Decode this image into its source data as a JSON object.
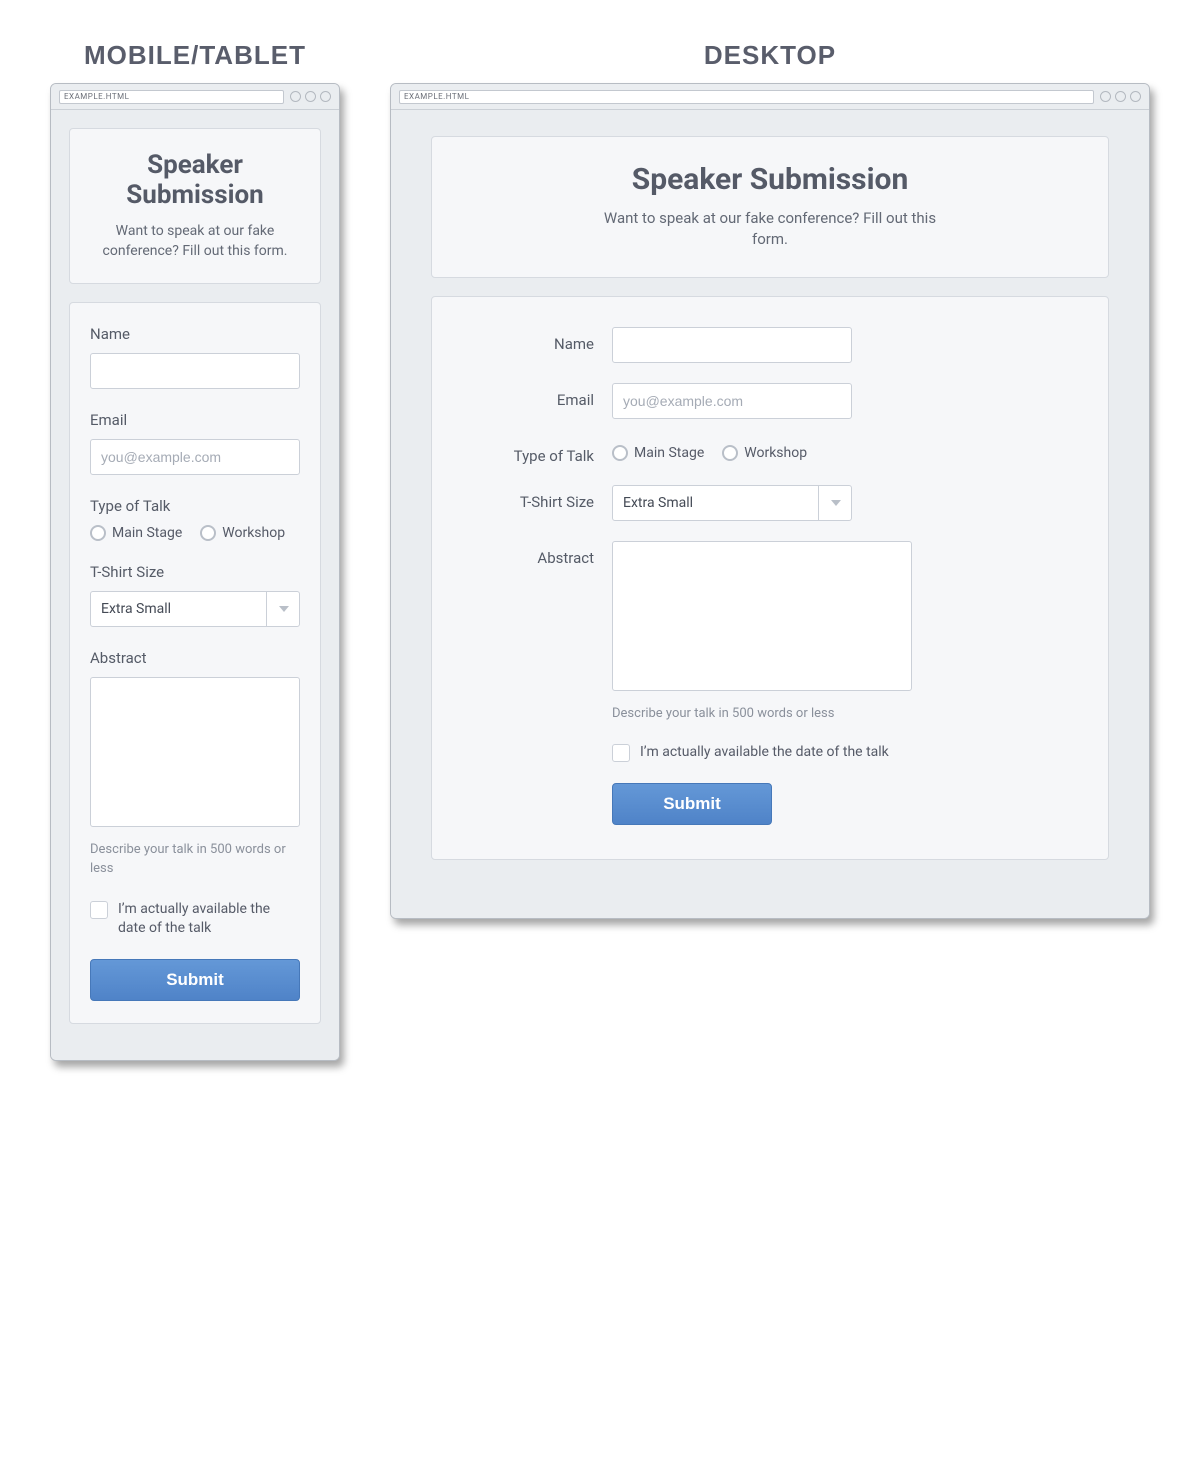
{
  "labels": {
    "mobile_heading": "Mobile/Tablet",
    "desktop_heading": "Desktop"
  },
  "browser": {
    "url": "EXAMPLE.HTML"
  },
  "header": {
    "title": "Speaker Submission",
    "subtitle": "Want to speak at our fake conference? Fill out this form."
  },
  "form": {
    "name_label": "Name",
    "email_label": "Email",
    "email_placeholder": "you@example.com",
    "talk_type_label": "Type of Talk",
    "talk_type_options": {
      "main_stage": "Main Stage",
      "workshop": "Workshop"
    },
    "tshirt_label": "T-Shirt Size",
    "tshirt_selected": "Extra Small",
    "abstract_label": "Abstract",
    "abstract_hint": "Describe your talk in 500 words or less",
    "availability_label": "I’m actually available the date of the talk",
    "submit_label": "Submit"
  }
}
